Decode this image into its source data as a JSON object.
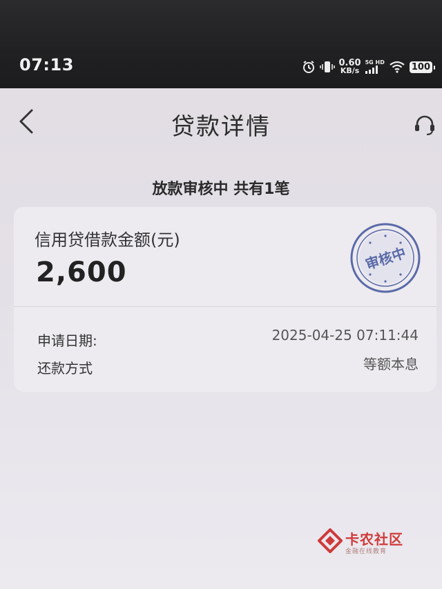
{
  "status_bar": {
    "time": "07:13",
    "speed_value": "0.60",
    "speed_unit": "KB/s",
    "network_top": "5G HD",
    "battery": "100"
  },
  "nav": {
    "title": "贷款详情",
    "back_icon": "chevron-left-icon",
    "service_icon": "headset-icon"
  },
  "summary": "放款审核中 共有1笔",
  "card": {
    "amount_label": "信用贷借款金额(元)",
    "amount": "2,600",
    "stamp_text": "审核中",
    "rows": [
      {
        "label": "申请日期:",
        "value": "2025-04-25 07:11:44"
      },
      {
        "label": "还款方式",
        "value": "等额本息"
      }
    ]
  },
  "watermark": {
    "title": "卡农社区",
    "subtitle": "金融在线教育"
  },
  "colors": {
    "stamp": "#5a6aa8",
    "watermark": "#cf3a3a"
  }
}
